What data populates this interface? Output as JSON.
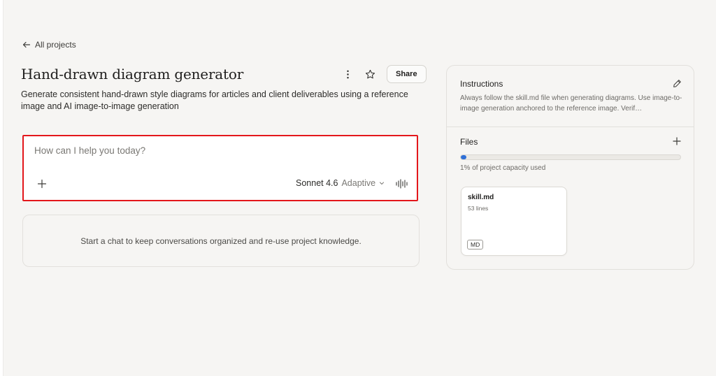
{
  "nav": {
    "back_label": "All projects"
  },
  "project": {
    "title": "Hand-drawn diagram generator",
    "description": "Generate consistent hand-drawn style diagrams for articles and client deliverables using a reference image and AI image-to-image generation",
    "share_label": "Share"
  },
  "composer": {
    "placeholder": "How can I help you today?",
    "model_name": "Sonnet 4.6",
    "model_mode": "Adaptive"
  },
  "empty_state": {
    "text": "Start a chat to keep conversations organized and re-use project knowledge."
  },
  "instructions": {
    "title": "Instructions",
    "text": "Always follow the skill.md file when generating diagrams. Use image-to-image generation anchored to the reference image. Verif…"
  },
  "files": {
    "title": "Files",
    "capacity_percent": 1,
    "capacity_text": "1% of project capacity used",
    "items": [
      {
        "name": "skill.md",
        "meta": "53 lines",
        "type": "MD"
      }
    ]
  },
  "colors": {
    "background": "#f6f5f3",
    "highlight_border": "#e3171b",
    "capacity_fill": "#2f6fd6"
  },
  "icons": [
    "arrow-left-icon",
    "more-vertical-icon",
    "star-icon",
    "plus-icon",
    "chevron-down-icon",
    "voice-wave-icon",
    "pencil-icon"
  ]
}
